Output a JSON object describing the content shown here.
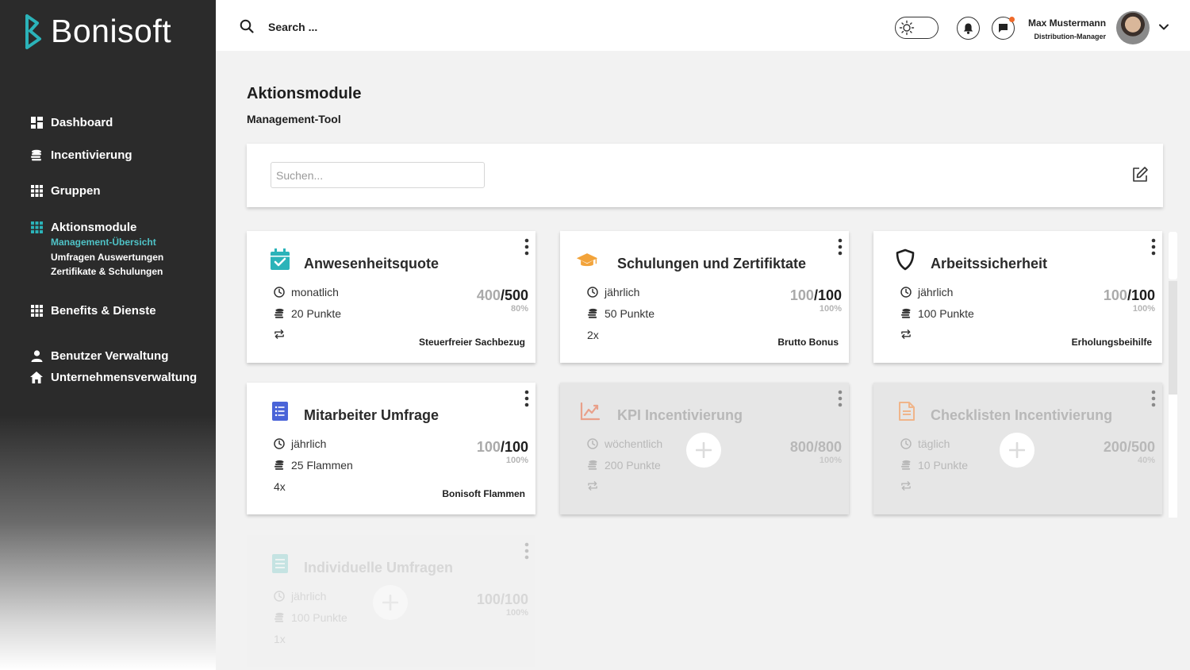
{
  "brand": {
    "name": "Bonisoft",
    "accent": "#2bb3b9"
  },
  "sidebar": {
    "items": [
      {
        "label": "Dashboard",
        "icon": "dashboard-icon"
      },
      {
        "label": "Incentivierung",
        "icon": "coins-icon"
      },
      {
        "label": "Gruppen",
        "icon": "grid-icon"
      },
      {
        "label": "Aktionsmodule",
        "icon": "grid-icon",
        "active": true,
        "subitems": [
          {
            "label": "Management-Übersicht",
            "active": true
          },
          {
            "label": "Umfragen Auswertungen"
          },
          {
            "label": "Zertifikate & Schulungen"
          }
        ]
      },
      {
        "label": "Benefits & Dienste",
        "icon": "grid-icon"
      },
      {
        "label": "Benutzer Verwaltung",
        "icon": "user-icon"
      },
      {
        "label": "Unternehmensverwaltung",
        "icon": "home-icon"
      }
    ]
  },
  "topbar": {
    "search_placeholder": "Search ...",
    "user": {
      "name": "Max Mustermann",
      "role": "Distribution-Manager"
    }
  },
  "page": {
    "title": "Aktionsmodule",
    "subtitle": "Management-Tool",
    "filter_placeholder": "Suchen..."
  },
  "cards": [
    {
      "title": "Anwesenheitsquote",
      "icon": "calendar-check-icon",
      "icon_color": "#2bb3b9",
      "frequency": "monatlich",
      "reward": "20 Punkte",
      "repeat": "",
      "current": "400",
      "total": "500",
      "percent": "80%",
      "tag": "Steuerfreier Sachbezug",
      "state": "active"
    },
    {
      "title": "Schulungen und Zertifiktate",
      "icon": "graduation-cap-icon",
      "icon_color": "#f2a33a",
      "frequency": "jährlich",
      "reward": "50 Punkte",
      "repeat": "2x",
      "current": "100",
      "total": "100",
      "percent": "100%",
      "tag": "Brutto Bonus",
      "state": "active"
    },
    {
      "title": "Arbeitssicherheit",
      "icon": "shield-icon",
      "icon_color": "#1e1e1e",
      "frequency": "jährlich",
      "reward": "100 Punkte",
      "repeat": "",
      "current": "100",
      "total": "100",
      "percent": "100%",
      "tag": "Erholungsbeihilfe",
      "state": "active"
    },
    {
      "title": "Mitarbeiter Umfrage",
      "icon": "list-icon",
      "icon_color": "#4a64d8",
      "frequency": "jährlich",
      "reward": "25 Flammen",
      "repeat": "4x",
      "current": "100",
      "total": "100",
      "percent": "100%",
      "tag": "Bonisoft Flammen",
      "state": "active"
    },
    {
      "title": "KPI Incentivierung",
      "icon": "chart-line-icon",
      "icon_color": "#e9a08a",
      "frequency": "wöchentlich",
      "reward": "200 Punkte",
      "repeat": "",
      "current": "800",
      "total": "800",
      "percent": "100%",
      "tag": "",
      "state": "disabled"
    },
    {
      "title": "Checklisten Incentivierung",
      "icon": "document-icon",
      "icon_color": "#f0b58a",
      "frequency": "täglich",
      "reward": "10 Punkte",
      "repeat": "",
      "current": "200",
      "total": "500",
      "percent": "40%",
      "tag": "",
      "state": "disabled"
    },
    {
      "title": "Individuelle Umfragen",
      "icon": "list-icon",
      "icon_color": "#8fd3cf",
      "frequency": "jährlich",
      "reward": "100 Punkte",
      "repeat": "1x",
      "current": "100",
      "total": "100",
      "percent": "100%",
      "tag": "",
      "state": "faded"
    }
  ]
}
